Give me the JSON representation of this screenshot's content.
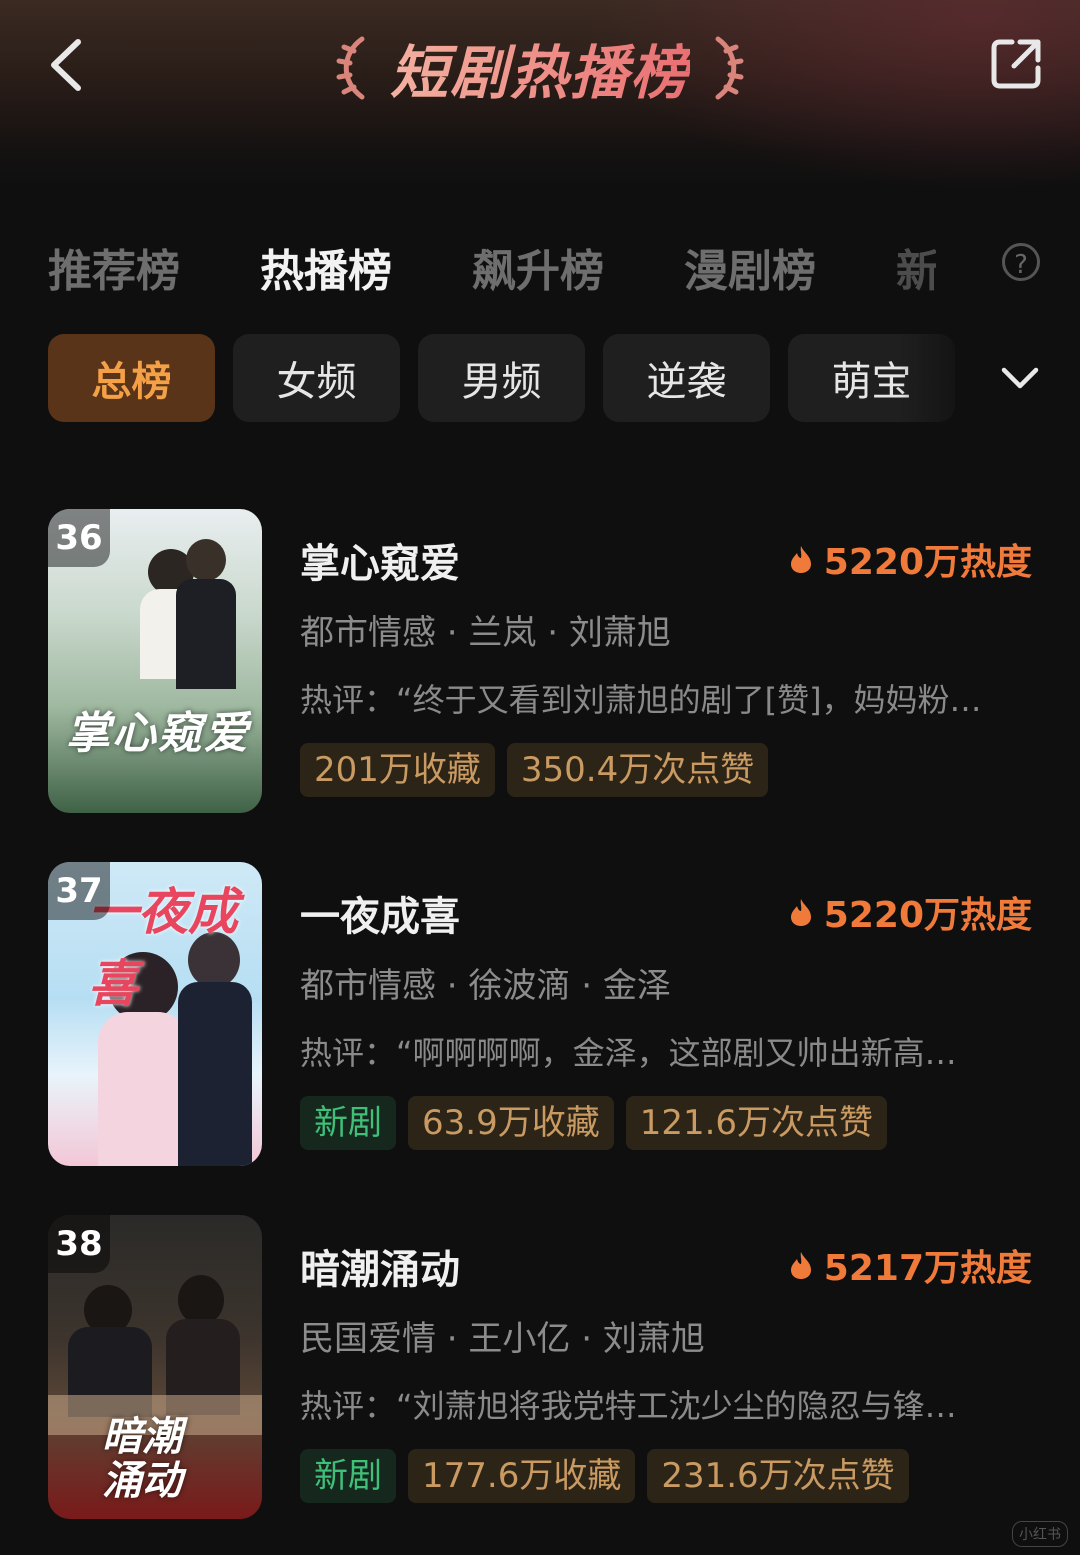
{
  "header": {
    "title": "短剧热播榜"
  },
  "tabs": [
    {
      "label": "推荐榜"
    },
    {
      "label": "热播榜"
    },
    {
      "label": "飙升榜"
    },
    {
      "label": "漫剧榜"
    },
    {
      "label": "新"
    }
  ],
  "active_tab": "热播榜",
  "help_icon": "?",
  "chips": [
    {
      "label": "总榜"
    },
    {
      "label": "女频"
    },
    {
      "label": "男频"
    },
    {
      "label": "逆袭"
    },
    {
      "label": "萌宝"
    }
  ],
  "active_chip": "总榜",
  "items": [
    {
      "rank": "36",
      "name": "掌心窥爱",
      "heat": "5220万热度",
      "genre": "都市情感 · 兰岚 · 刘萧旭",
      "comment": "热评：“终于又看到刘萧旭的剧了[赞]，妈妈粉…",
      "tags": [
        "201万收藏",
        "350.4万次点赞"
      ],
      "new_tag": "",
      "poster_text": "掌心窥爱",
      "poster_colors": [
        "#e9eef0",
        "#9fb8a0",
        "#3f6246"
      ]
    },
    {
      "rank": "37",
      "name": "一夜成喜",
      "heat": "5220万热度",
      "genre": "都市情感 · 徐波滴 · 金泽",
      "comment": "热评：“啊啊啊啊，金泽，这部剧又帅出新高…",
      "tags": [
        "63.9万收藏",
        "121.6万次点赞"
      ],
      "new_tag": "新剧",
      "poster_text": "一夜成喜",
      "poster_colors": [
        "#cfe9f6",
        "#a9d6ef",
        "#f3c7d6"
      ]
    },
    {
      "rank": "38",
      "name": "暗潮涌动",
      "heat": "5217万热度",
      "genre": "民国爱情 · 王小亿 · 刘萧旭",
      "comment": "热评：“刘萧旭将我党特工沈少尘的隐忍与锋…",
      "tags": [
        "177.6万收藏",
        "231.6万次点赞"
      ],
      "new_tag": "新剧",
      "poster_text": "暗潮涌动",
      "poster_colors": [
        "#2b2a28",
        "#5a4636",
        "#7a1a1a"
      ]
    }
  ],
  "watermark": "小红书",
  "colors": {
    "heat": "#f07a3a",
    "active_chip_bg": "#5a3418",
    "active_chip_text": "#f3a046",
    "new_tag": "#3fbf78",
    "stat_tag": "#c99a62"
  }
}
